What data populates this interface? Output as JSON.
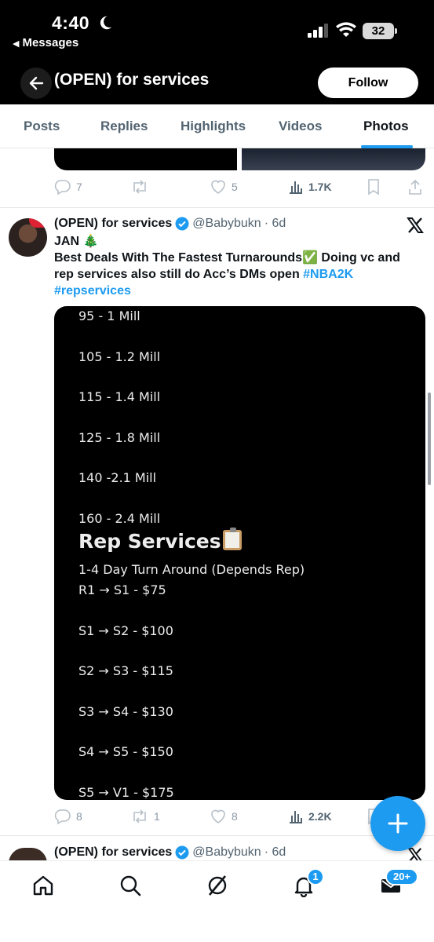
{
  "status_bar": {
    "time": "4:40",
    "back_app": "Messages",
    "battery": "32"
  },
  "header": {
    "title": "(OPEN) for services",
    "follow_label": "Follow"
  },
  "tabs": [
    {
      "label": "Posts",
      "active": false
    },
    {
      "label": "Replies",
      "active": false
    },
    {
      "label": "Highlights",
      "active": false
    },
    {
      "label": "Videos",
      "active": false
    },
    {
      "label": "Photos",
      "active": true
    }
  ],
  "prev_tweet": {
    "replies": "7",
    "reposts": "",
    "likes": "5",
    "views": "1.7K"
  },
  "tweet": {
    "name": "(OPEN) for services",
    "handle": "@Babybukn",
    "time": "· 6d",
    "line1": "JAN 🎄",
    "line2_text": "Best Deals With The Fastest Turnarounds✅ Doing vc and rep services also still do Acc’s DMs open ",
    "hashtag1": "#NBA2K",
    "hashtag2": "#repservices",
    "media": {
      "vc_prices": [
        "95 - 1 Mill",
        "105 - 1.2 Mill",
        "115 - 1.4 Mill",
        "125 - 1.8 Mill",
        "140 -2.1 Mill",
        "160 - 2.4 Mill"
      ],
      "heading": "Rep Services",
      "subtitle": "1-4 Day Turn Around (Depends Rep)",
      "rep_prices": [
        "R1 → S1 - $75",
        "S1 → S2 - $100",
        "S2 → S3 - $115",
        "S3 → S4 - $130",
        "S4 → S5 - $150",
        "S5 → V1 - $175"
      ]
    },
    "replies": "8",
    "reposts": "1",
    "likes": "8",
    "views": "2.2K"
  },
  "next_tweet": {
    "name": "(OPEN) for services",
    "handle": "@Babybukn",
    "time": "· 6d"
  },
  "bottom_nav": {
    "notifications_badge": "1",
    "messages_badge": "20+"
  },
  "colors": {
    "accent": "#1d9bf0",
    "text": "#0f1419",
    "muted": "#536471"
  }
}
